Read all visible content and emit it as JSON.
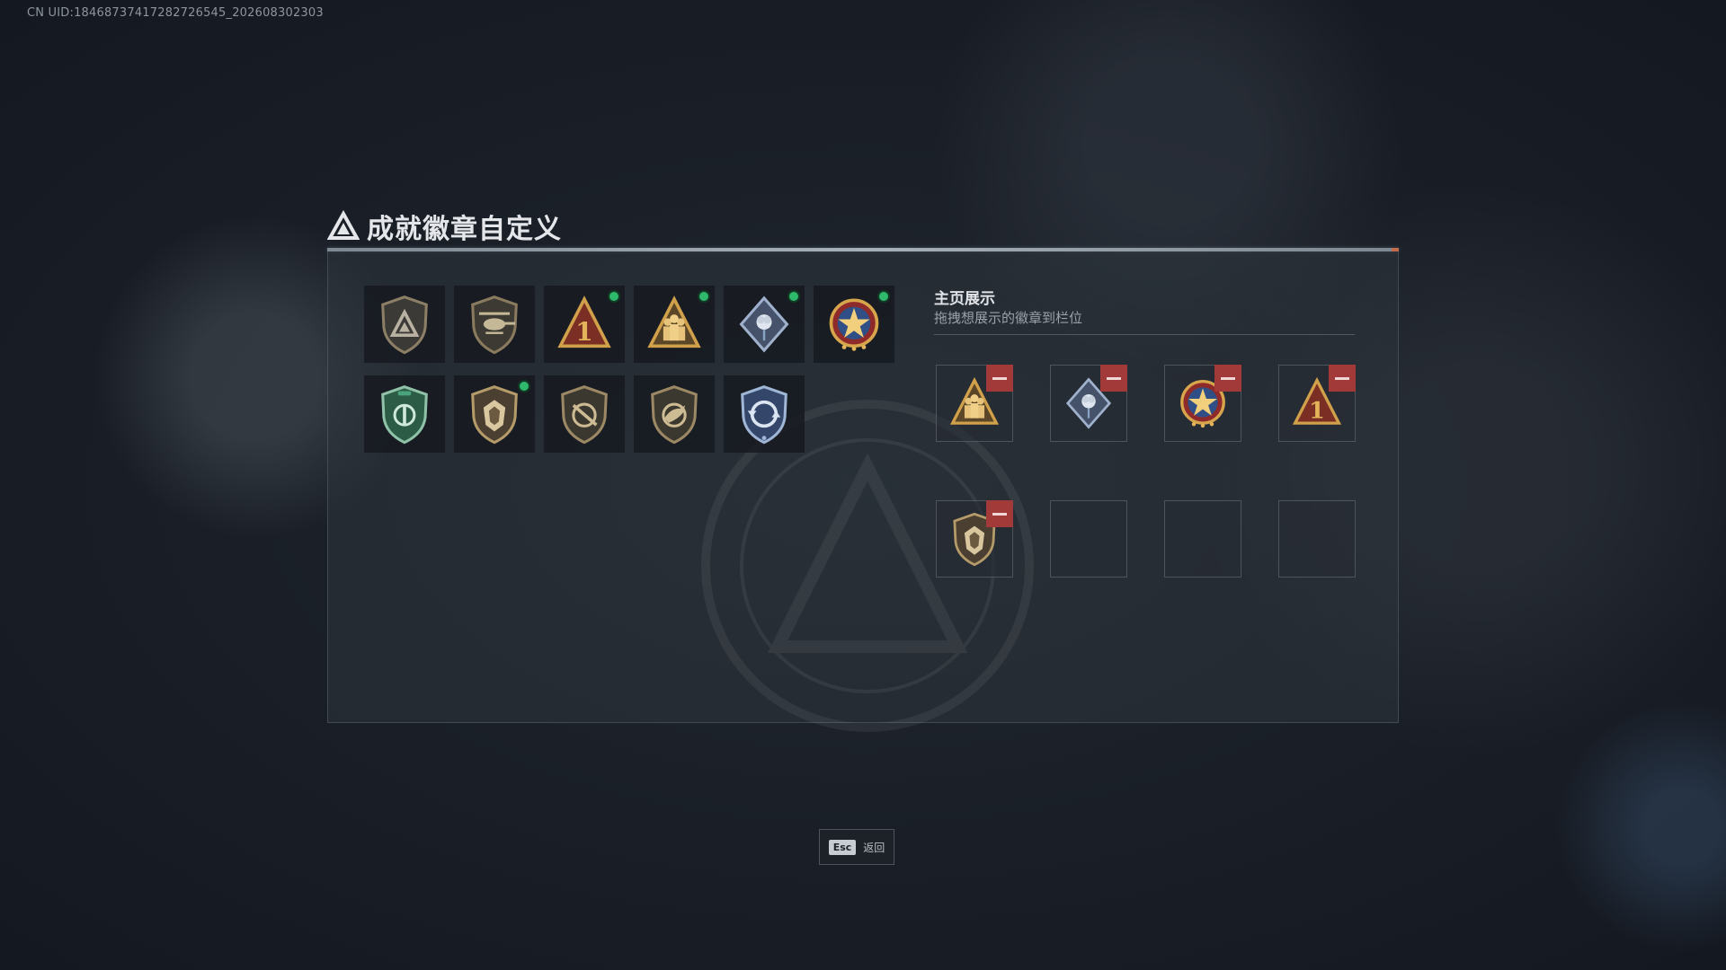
{
  "uid_text": "CN UID:1846873741728272​6545_202608302303",
  "title": "成就徽章自定义",
  "owned_badges": [
    {
      "icon": "triangle-shield-badge-icon",
      "new": false
    },
    {
      "icon": "helicopter-badge-icon",
      "new": false
    },
    {
      "icon": "number-one-triangle-badge-icon",
      "new": true
    },
    {
      "icon": "soldiers-triangle-badge-icon",
      "new": true
    },
    {
      "icon": "rose-diamond-badge-icon",
      "new": true
    },
    {
      "icon": "star-wreath-badge-icon",
      "new": true
    },
    {
      "icon": "green-shield-badge-icon",
      "new": false
    },
    {
      "icon": "lion-shield-badge-icon",
      "new": true
    },
    {
      "icon": "rifle-shield-badge-icon",
      "new": false
    },
    {
      "icon": "dino-shield-badge-icon",
      "new": false
    },
    {
      "icon": "cycle-shield-badge-icon",
      "new": false
    }
  ],
  "showcase": {
    "title": "主页展示",
    "subtitle": "拖拽想展示的徽章到栏位",
    "slots": [
      {
        "icon": "soldiers-triangle-badge-icon",
        "filled": true
      },
      {
        "icon": "rose-diamond-badge-icon",
        "filled": true
      },
      {
        "icon": "star-wreath-badge-icon",
        "filled": true
      },
      {
        "icon": "number-one-triangle-badge-icon",
        "filled": true
      },
      {
        "icon": "lion-shield-badge-icon",
        "filled": true
      },
      {
        "icon": "",
        "filled": false
      },
      {
        "icon": "",
        "filled": false
      },
      {
        "icon": "",
        "filled": false
      }
    ]
  },
  "esc": {
    "key": "Esc",
    "label": "返回"
  },
  "colors": {
    "new_dot": "#2fb96c",
    "remove": "#a33a3a",
    "gold": "#c9a14a"
  }
}
